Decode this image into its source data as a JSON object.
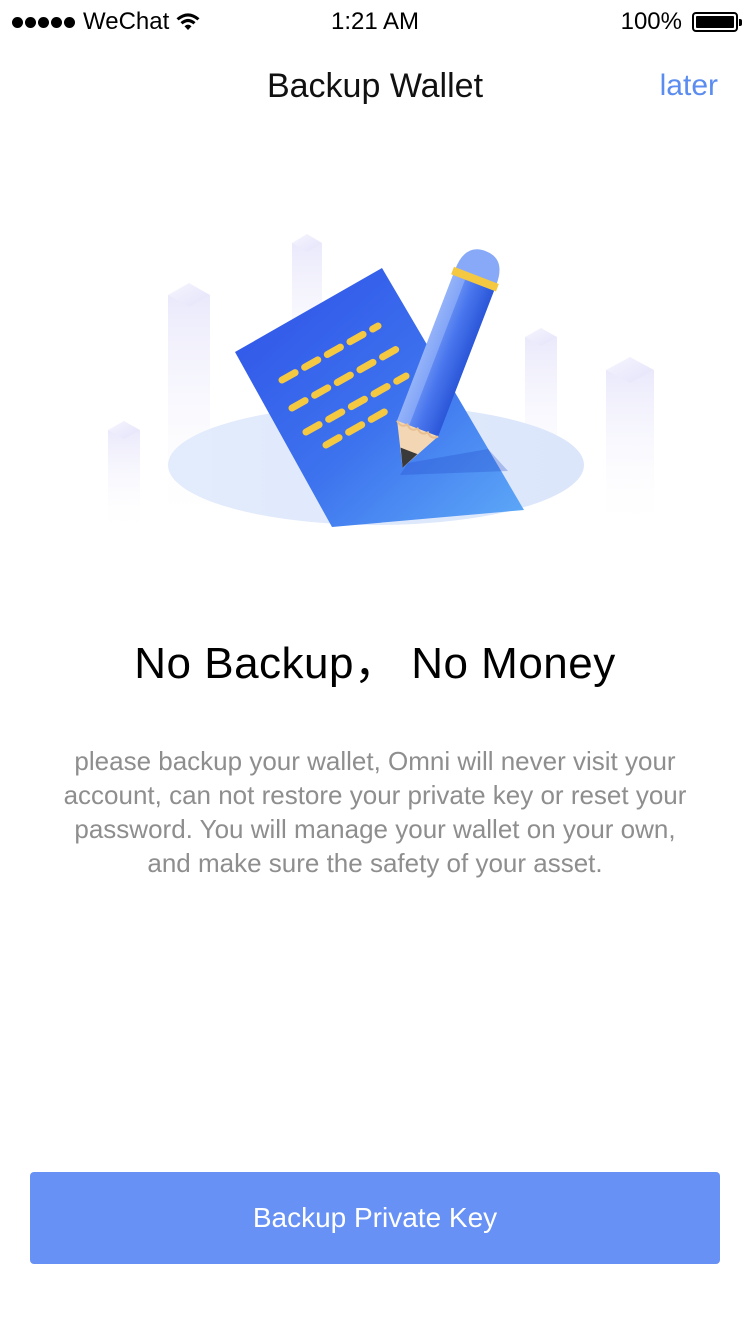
{
  "status_bar": {
    "carrier": "WeChat",
    "time": "1:21 AM",
    "battery": "100%",
    "signal_icon": "signal-dots-icon",
    "wifi_icon": "wifi-icon",
    "battery_icon": "battery-icon"
  },
  "nav": {
    "title": "Backup Wallet",
    "later_label": "later"
  },
  "illustration": {
    "icon": "document-pencil-illustration"
  },
  "content": {
    "headline": "No Backup， No Money",
    "description": "please backup your wallet, Omni will never visit your account, can not restore your private key or reset your password. You will manage your wallet on your own, and make sure the safety of your asset."
  },
  "actions": {
    "primary_label": "Backup Private Key"
  },
  "colors": {
    "accent": "#6791f5",
    "link": "#5b8cf0",
    "body_text": "#8e8e8e"
  }
}
